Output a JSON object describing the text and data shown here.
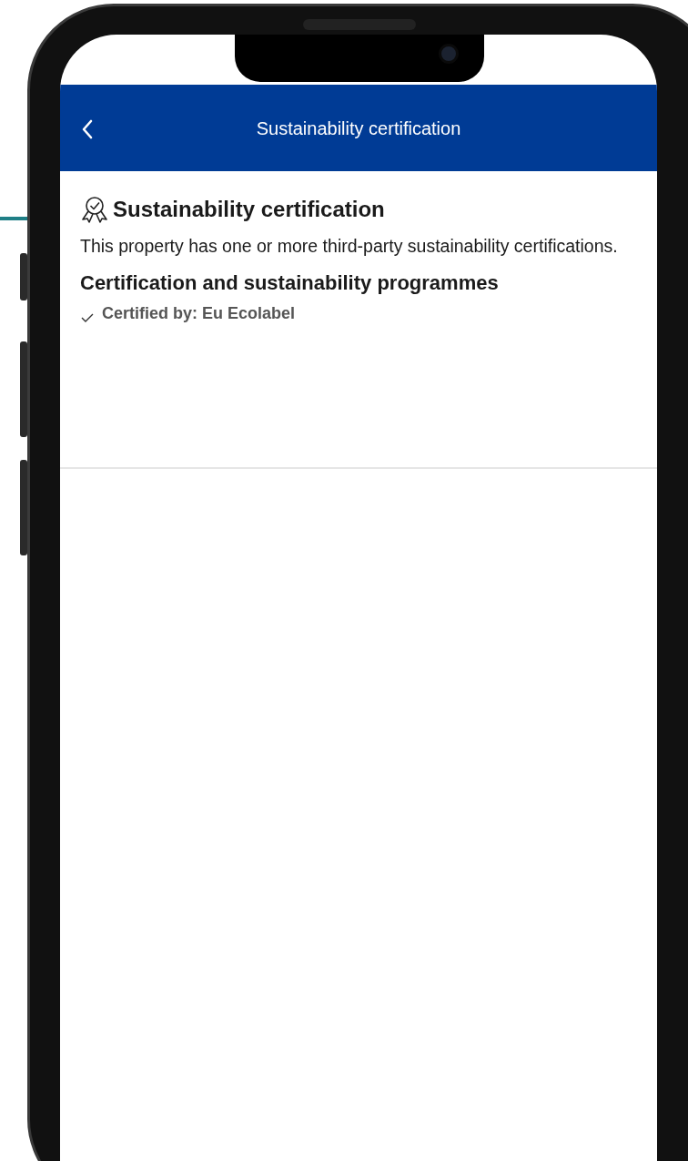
{
  "header": {
    "title": "Sustainability certification"
  },
  "section": {
    "title": "Sustainability certification",
    "description": "This property has one or more third-party sustainability certifications."
  },
  "programmes": {
    "title": "Certification and sustainability programmes",
    "items": [
      {
        "label": "Certified by: Eu Ecolabel"
      }
    ]
  }
}
